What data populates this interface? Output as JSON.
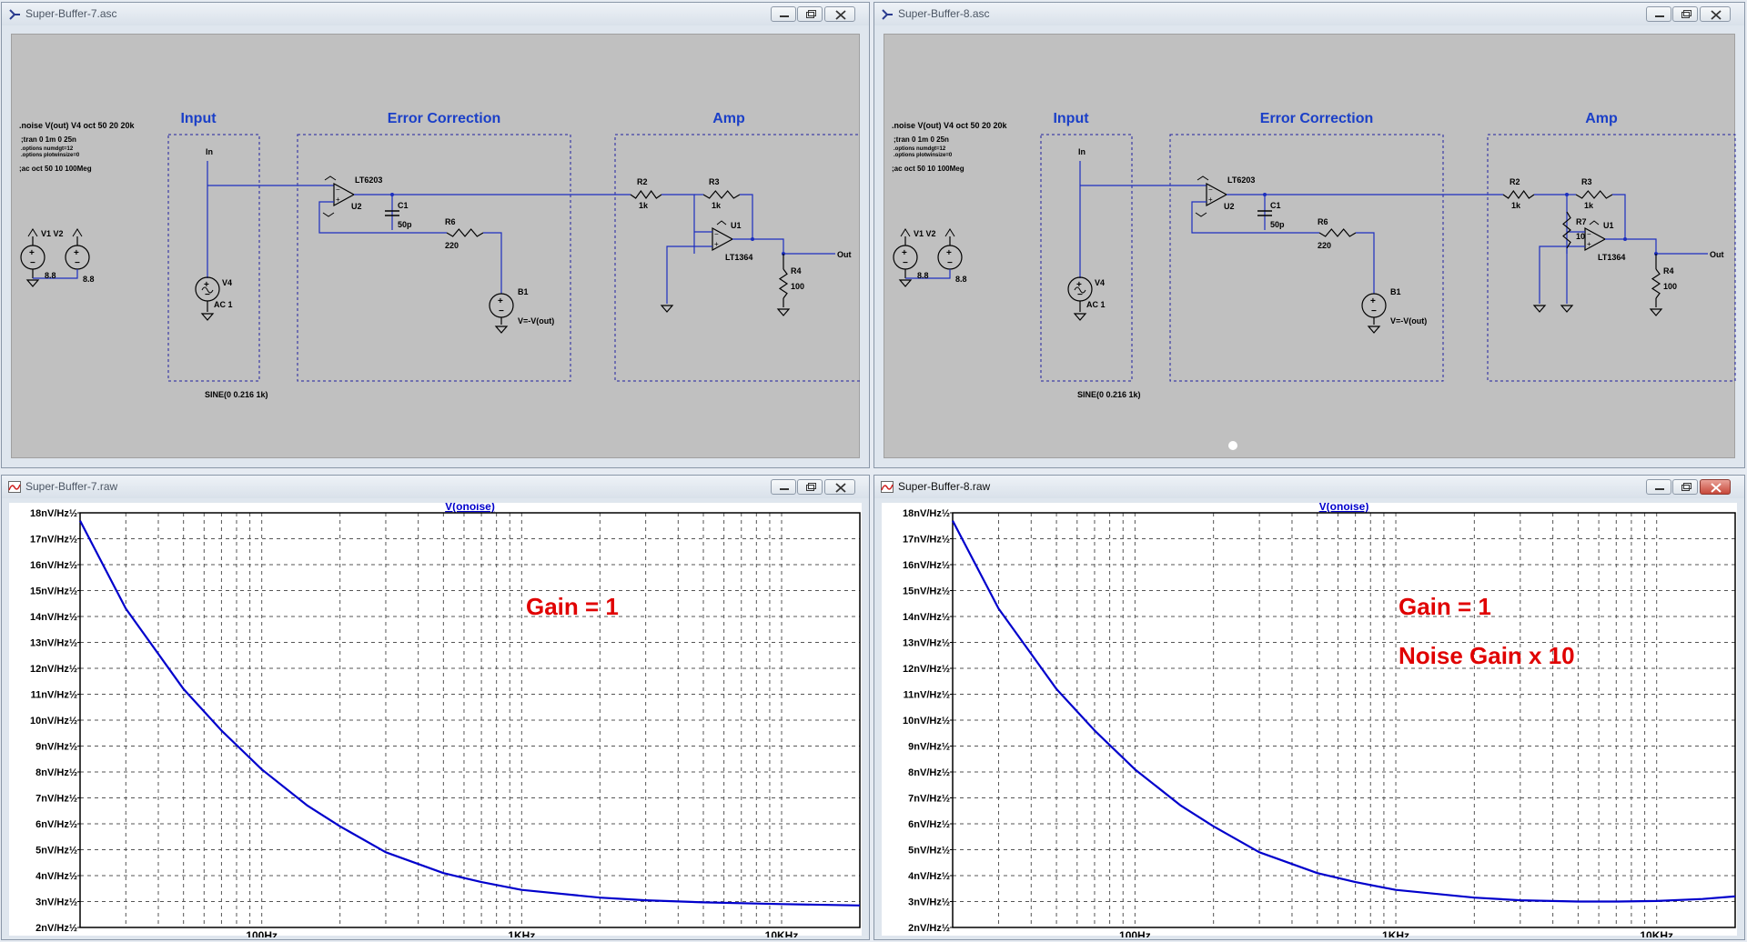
{
  "colors": {
    "wire": "#1c2fbf",
    "label": "#1a3fc8",
    "curve": "#0000cc",
    "annotation": "#e00000",
    "grid": "#000000"
  },
  "windows": [
    {
      "title": "Super-Buffer-7.asc"
    },
    {
      "title": "Super-Buffer-8.asc"
    },
    {
      "title": "Super-Buffer-7.raw"
    },
    {
      "title": "Super-Buffer-8.raw"
    }
  ],
  "schematic": {
    "directives": [
      ".noise V(out) V4 oct 50 20 20k",
      ";tran 0 1m 0 25n",
      ".options numdgt=12",
      ".options plotwinsize=0",
      ";ac oct 50 10 100Meg"
    ],
    "sections": [
      "Input",
      "Error Correction",
      "Amp"
    ],
    "labels": {
      "in": "In",
      "v4": "V4",
      "ac1": "AC 1",
      "sine": "SINE(0 0.216 1k)",
      "v1v2": "V1 V2",
      "v1val": "8.8",
      "v2val": "8.8",
      "lt6203": "LT6203",
      "u2": "U2",
      "c1": "C1",
      "c1val": "50p",
      "r6": "R6",
      "r6val": "220",
      "b1": "B1",
      "b1val": "V=-V(out)",
      "r2": "R2",
      "r2val": "1k",
      "r3": "R3",
      "r3val": "1k",
      "u1": "U1",
      "lt1364": "LT1364",
      "r4": "R4",
      "r4val": "100",
      "out": "Out",
      "r7": "R7",
      "r7val": "10"
    }
  },
  "plots": [
    {
      "trace": "V(onoise)",
      "annotation1": "Gain = 1",
      "annotation2": ""
    },
    {
      "trace": "V(onoise)",
      "annotation1": "Gain = 1",
      "annotation2": "Noise Gain x 10"
    }
  ],
  "chart_data": [
    {
      "type": "line",
      "title": "V(onoise)",
      "xscale": "log",
      "xlim": [
        20,
        20000
      ],
      "ylim": [
        2,
        18
      ],
      "yunit": "nV/Hz½",
      "xticks": [
        "100Hz",
        "1KHz",
        "10KHz"
      ],
      "yticks": [
        "18nV/Hz½",
        "17nV/Hz½",
        "16nV/Hz½",
        "15nV/Hz½",
        "14nV/Hz½",
        "13nV/Hz½",
        "12nV/Hz½",
        "11nV/Hz½",
        "10nV/Hz½",
        "9nV/Hz½",
        "8nV/Hz½",
        "7nV/Hz½",
        "6nV/Hz½",
        "5nV/Hz½",
        "4nV/Hz½",
        "3nV/Hz½",
        "2nV/Hz½"
      ],
      "series": [
        {
          "x": [
            20,
            30,
            50,
            70,
            100,
            150,
            200,
            300,
            500,
            700,
            1000,
            2000,
            3000,
            5000,
            10000,
            20000
          ],
          "y": [
            17.7,
            14.3,
            11.2,
            9.6,
            8.1,
            6.7,
            5.9,
            4.9,
            4.1,
            3.75,
            3.45,
            3.15,
            3.05,
            2.97,
            2.9,
            2.85
          ]
        }
      ]
    },
    {
      "type": "line",
      "title": "V(onoise)",
      "xscale": "log",
      "xlim": [
        20,
        20000
      ],
      "ylim": [
        2,
        18
      ],
      "yunit": "nV/Hz½",
      "xticks": [
        "100Hz",
        "1KHz",
        "10KHz"
      ],
      "yticks": [
        "18nV/Hz½",
        "17nV/Hz½",
        "16nV/Hz½",
        "15nV/Hz½",
        "14nV/Hz½",
        "13nV/Hz½",
        "12nV/Hz½",
        "11nV/Hz½",
        "10nV/Hz½",
        "9nV/Hz½",
        "8nV/Hz½",
        "7nV/Hz½",
        "6nV/Hz½",
        "5nV/Hz½",
        "4nV/Hz½",
        "3nV/Hz½",
        "2nV/Hz½"
      ],
      "series": [
        {
          "x": [
            20,
            30,
            50,
            70,
            100,
            150,
            200,
            300,
            500,
            700,
            1000,
            2000,
            3000,
            5000,
            7000,
            10000,
            15000,
            20000
          ],
          "y": [
            17.7,
            14.3,
            11.2,
            9.6,
            8.1,
            6.7,
            5.9,
            4.9,
            4.1,
            3.75,
            3.45,
            3.15,
            3.05,
            3.0,
            3.0,
            3.02,
            3.1,
            3.2
          ]
        }
      ]
    }
  ]
}
